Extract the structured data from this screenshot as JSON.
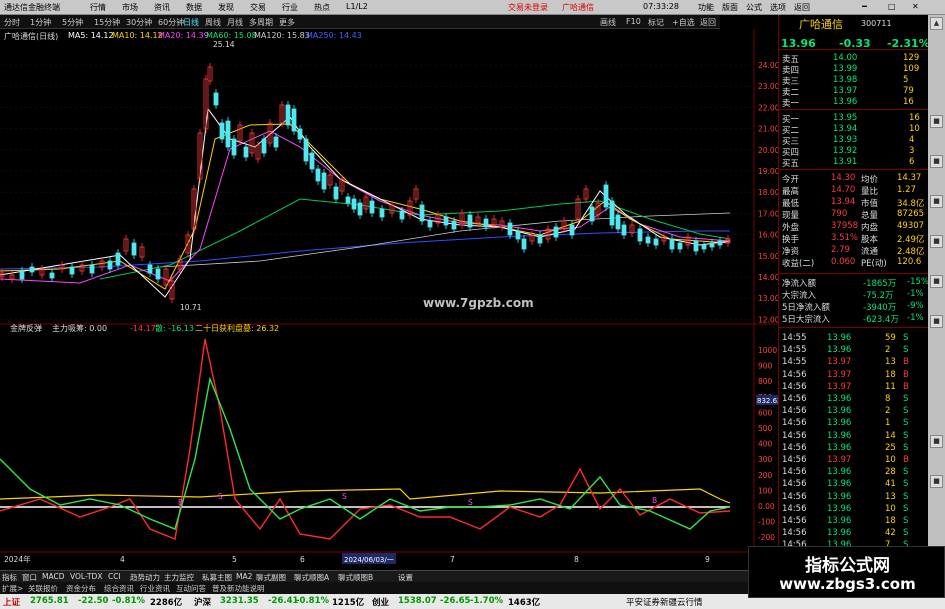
{
  "app": {
    "title": "通达信金融终端",
    "menu": [
      "行情",
      "市场",
      "资讯",
      "数据",
      "发现",
      "交易",
      "行业",
      "热点",
      "L1/L2"
    ],
    "right_menu": [
      "功能",
      "版面",
      "公式",
      "选项",
      "返回"
    ],
    "red_links": [
      "交易未登录",
      "广哈通信"
    ],
    "time": "07:33:28"
  },
  "period_bar": {
    "items": [
      "分时",
      "1分钟",
      "5分钟",
      "15分钟",
      "30分钟",
      "60分钟",
      "日线",
      "周线",
      "月线",
      "多周期",
      "更多"
    ],
    "tools": [
      "画线",
      "F10",
      "标记",
      "+自选",
      "返回"
    ]
  },
  "chart_header": {
    "name": "广哈通信(日线)",
    "ma5": "MA5: 14.12",
    "ma10": "MA10: 14.12",
    "ma20": "MA20: 14.39",
    "ma60": "MA60: 15.08",
    "ma120": "MA120: 15.83",
    "ma250": "MA250: 14.43"
  },
  "price_annotations": {
    "high": "25.14",
    "low": "10.71"
  },
  "price_axis": [
    "24.00",
    "23.00",
    "22.00",
    "21.00",
    "20.00",
    "19.00",
    "18.00",
    "17.00",
    "16.00",
    "15.00",
    "14.00",
    "13.00",
    "12.00"
  ],
  "site_watermark": "www.7gpzb.com",
  "indicator_header": {
    "name": "金牌反弹",
    "main_force": "主力吸筹: 0.00",
    "v1": "-14.17",
    "v2": "散: -16.13",
    "v3": "二十日获利盘墓: 26.32"
  },
  "indicator_axis": [
    "1000",
    "900",
    "800",
    "700",
    "600",
    "500",
    "400",
    "300",
    "200",
    "100",
    "0.00",
    "-100",
    "-200",
    "-300"
  ],
  "indicator_marker": "832.62",
  "date_axis": {
    "labels": [
      "2024年",
      "4",
      "5",
      "6",
      "7",
      "8",
      "9"
    ],
    "cursor": "2024/06/03/一"
  },
  "markers": [
    "B",
    "S",
    "S",
    "S",
    "B"
  ],
  "quote": {
    "name": "广哈通信",
    "code": "300711",
    "price": "13.96",
    "change": "-0.33",
    "pct": "-2.31%",
    "asks": [
      {
        "label": "卖五",
        "price": "14.00",
        "vol": "129"
      },
      {
        "label": "卖四",
        "price": "13.99",
        "vol": "109"
      },
      {
        "label": "卖三",
        "price": "13.98",
        "vol": "5"
      },
      {
        "label": "卖二",
        "price": "13.97",
        "vol": "79"
      },
      {
        "label": "卖一",
        "price": "13.96",
        "vol": "16"
      }
    ],
    "bids": [
      {
        "label": "买一",
        "price": "13.95",
        "vol": "16"
      },
      {
        "label": "买二",
        "price": "13.94",
        "vol": "10"
      },
      {
        "label": "买三",
        "price": "13.93",
        "vol": "4"
      },
      {
        "label": "买四",
        "price": "13.92",
        "vol": "3"
      },
      {
        "label": "买五",
        "price": "13.91",
        "vol": "6"
      }
    ],
    "stats": [
      {
        "l1": "今开",
        "v1": "14.30",
        "l2": "均价",
        "v2": "14.37"
      },
      {
        "l1": "最高",
        "v1": "14.70",
        "l2": "量比",
        "v2": "1.27"
      },
      {
        "l1": "最低",
        "v1": "13.94",
        "l2": "市值",
        "v2": "34.8亿"
      },
      {
        "l1": "现量",
        "v1": "790",
        "l2": "总量",
        "v2": "87265"
      },
      {
        "l1": "外盘",
        "v1": "37958",
        "l2": "内盘",
        "v2": "49307"
      },
      {
        "l1": "换手",
        "v1": "3.51%",
        "l2": "股本",
        "v2": "2.49亿"
      },
      {
        "l1": "净资",
        "v1": "2.79",
        "l2": "流通",
        "v2": "2.48亿"
      },
      {
        "l1": "收益(二)",
        "v1": "0.060",
        "l2": "PE(动)",
        "v2": "120.6"
      }
    ],
    "flows": [
      {
        "label": "净流入额",
        "val": "-1865万",
        "pct": "-15%"
      },
      {
        "label": "大宗流入",
        "val": "-75.2万",
        "pct": "-1%"
      },
      {
        "label": "5日净流入额",
        "val": "-3940万",
        "pct": "-9%"
      },
      {
        "label": "5日大宗流入",
        "val": "-623.4万",
        "pct": "-1%"
      }
    ],
    "ticks": [
      {
        "t": "14:55",
        "p": "13.96",
        "v": "59",
        "s": "S"
      },
      {
        "t": "14:55",
        "p": "13.96",
        "v": "2",
        "s": "S"
      },
      {
        "t": "14:55",
        "p": "13.97",
        "v": "13",
        "s": "B"
      },
      {
        "t": "14:56",
        "p": "13.97",
        "v": "18",
        "s": "B"
      },
      {
        "t": "14:56",
        "p": "13.97",
        "v": "11",
        "s": "B"
      },
      {
        "t": "14:56",
        "p": "13.96",
        "v": "8",
        "s": "S"
      },
      {
        "t": "14:56",
        "p": "13.96",
        "v": "2",
        "s": "S"
      },
      {
        "t": "14:56",
        "p": "13.96",
        "v": "1",
        "s": "S"
      },
      {
        "t": "14:56",
        "p": "13.96",
        "v": "14",
        "s": "S"
      },
      {
        "t": "14:56",
        "p": "13.96",
        "v": "25",
        "s": "S"
      },
      {
        "t": "14:56",
        "p": "13.97",
        "v": "10",
        "s": "B"
      },
      {
        "t": "14:56",
        "p": "13.96",
        "v": "28",
        "s": "S"
      },
      {
        "t": "14:56",
        "p": "13.96",
        "v": "41",
        "s": "S"
      },
      {
        "t": "14:56",
        "p": "13.96",
        "v": "13",
        "s": "S"
      },
      {
        "t": "14:56",
        "p": "13.96",
        "v": "10",
        "s": "S"
      },
      {
        "t": "14:56",
        "p": "13.96",
        "v": "18",
        "s": "S"
      },
      {
        "t": "14:56",
        "p": "13.96",
        "v": "42",
        "s": "S"
      },
      {
        "t": "14:56",
        "p": "13.96",
        "v": "7",
        "s": "S"
      }
    ]
  },
  "bottom_tabs": [
    "指标",
    "窗口",
    "MACD",
    "VOL-TDX",
    "CCI",
    "趋势动力",
    "主力监控",
    "私募主图",
    "MA2",
    "聊式副图",
    "聊式顺图A",
    "聊式顺图B",
    "设置"
  ],
  "bottom_tabs2": [
    "扩展>",
    "关联报价",
    "资金分布",
    "综合资讯",
    "行业资讯",
    "互动问答",
    "普及新功能说明"
  ],
  "status": {
    "sh": "上证",
    "sh_val": "2765.81",
    "sh_chg": "-22.50",
    "sh_pct": "-0.81%",
    "sh_amt": "2286亿",
    "hs": "沪深",
    "hs_val": "3231.35",
    "hs_chg": "-26.41",
    "hs_pct": "-0.81%",
    "hs_amt": "1215亿",
    "cy": "创业",
    "cy_val": "1538.07",
    "cy_chg": "-26.65",
    "cy_pct": "-1.70%",
    "cy_amt": "1463亿",
    "broker": "平安证券新疆云行情"
  },
  "logo": {
    "line1": "指标公式网",
    "line2": "www.zbgs3.com"
  },
  "colors": {
    "up": "#ff3b3b",
    "down": "#00e676",
    "cyan": "#4fe8f0",
    "yellow": "#ffd400",
    "magenta": "#ff44ff"
  }
}
